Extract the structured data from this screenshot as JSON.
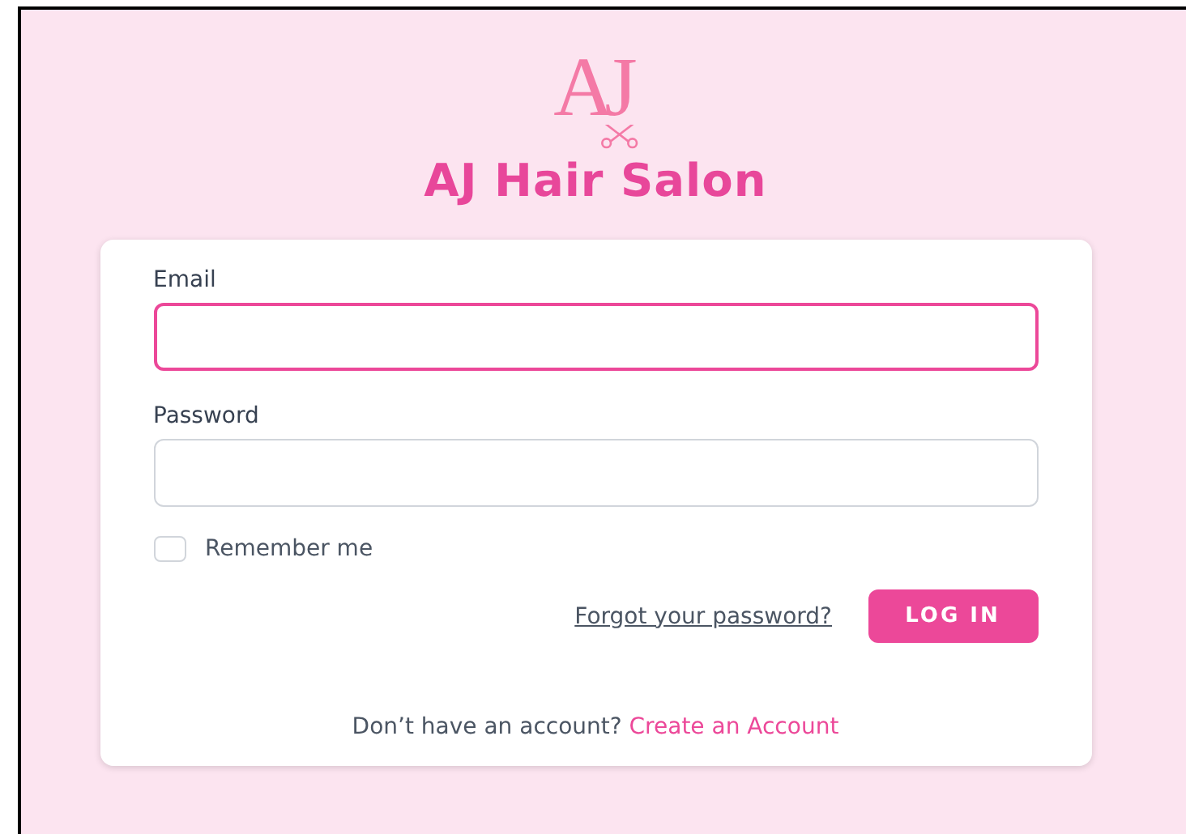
{
  "logo": {
    "text": "AJ"
  },
  "title": "AJ Hair Salon",
  "form": {
    "fields": [
      {
        "label": "Email",
        "focused": true
      },
      {
        "label": "Password",
        "focused": false
      }
    ],
    "remember": {
      "label": "Remember me",
      "checked": false
    },
    "forgot_link": "Forgot your password?",
    "submit": "LOG IN",
    "signup_prompt": "Don’t have an account?",
    "signup_link": "Create an Account"
  }
}
